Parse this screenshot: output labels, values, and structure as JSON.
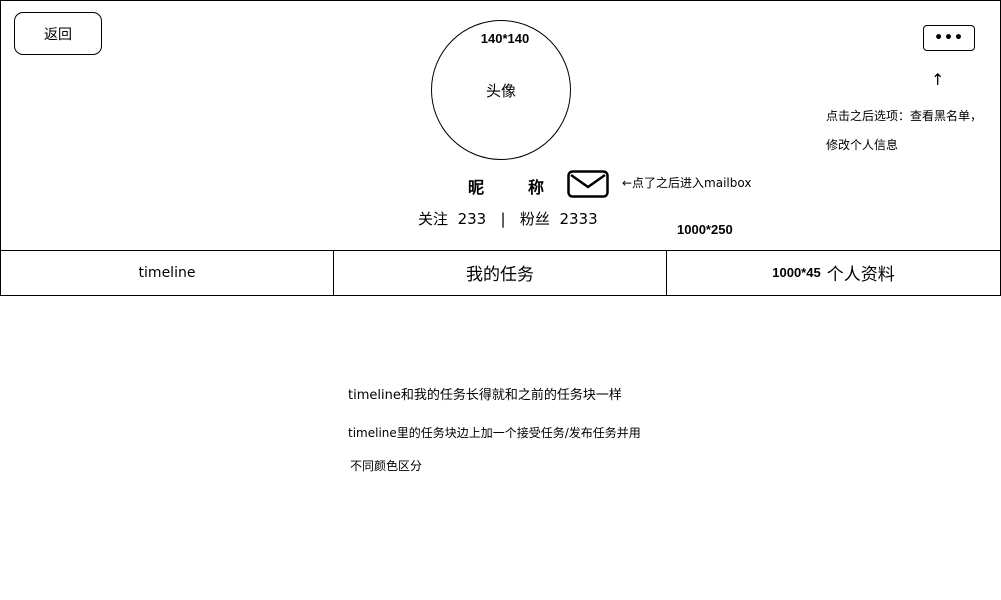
{
  "header": {
    "back_label": "返回",
    "more_label": "•••",
    "avatar_label": "头像",
    "avatar_size_note": "140*140",
    "nickname": "昵称",
    "mail_note": "←点了之后进入mailbox",
    "more_note_line1": "点击之后选项：查看黑名单，",
    "more_note_line2": "修改个人信息",
    "up_arrow": "↑",
    "size_note": "1000*250",
    "stats": {
      "following_label": "关注",
      "following_count": "233",
      "divider": "|",
      "followers_label": "粉丝",
      "followers_count": "2333"
    }
  },
  "tabs": {
    "timeline": "timeline",
    "my_tasks": "我的任务",
    "size_note": "1000*45",
    "profile": "个人资料"
  },
  "notes": {
    "line1": "timeline和我的任务长得就和之前的任务块一样",
    "line2": "timeline里的任务块边上加一个接受任务/发布任务并用",
    "line3": "不同颜色区分"
  },
  "icons": {
    "mail": "mail-icon",
    "more": "more-icon"
  }
}
